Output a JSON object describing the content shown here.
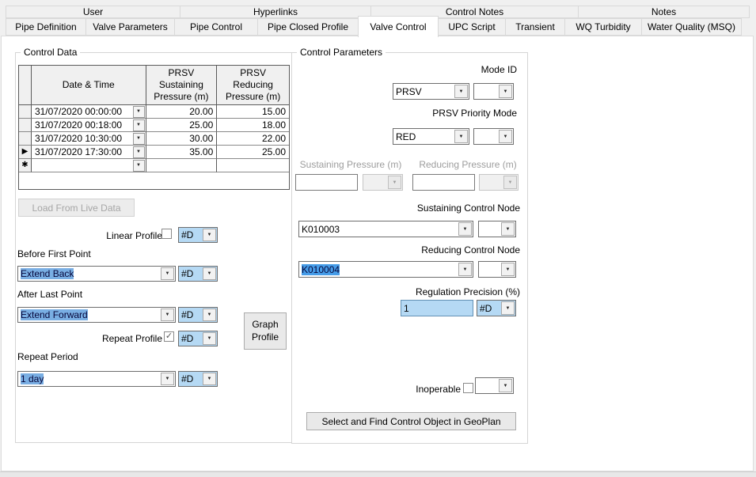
{
  "tabs": {
    "row1": [
      {
        "label": "User"
      },
      {
        "label": "Hyperlinks"
      },
      {
        "label": "Control Notes"
      },
      {
        "label": "Notes"
      }
    ],
    "row2": [
      {
        "label": "Pipe Definition"
      },
      {
        "label": "Valve Parameters"
      },
      {
        "label": "Pipe Control"
      },
      {
        "label": "Pipe Closed Profile"
      },
      {
        "label": "Valve Control",
        "active": true
      },
      {
        "label": "UPC Script"
      },
      {
        "label": "Transient"
      },
      {
        "label": "WQ Turbidity"
      },
      {
        "label": "Water Quality (MSQ)"
      }
    ],
    "active_tab": "Valve Control"
  },
  "control_data": {
    "title": "Control Data",
    "table": {
      "columns": [
        "Date & Time",
        "PRSV Sustaining Pressure (m)",
        "PRSV Reducing Pressure (m)"
      ],
      "rows": [
        {
          "marker": "",
          "datetime": "31/07/2020 00:00:00",
          "sustaining": "20.00",
          "reducing": "15.00"
        },
        {
          "marker": "",
          "datetime": "31/07/2020 00:18:00",
          "sustaining": "25.00",
          "reducing": "18.00"
        },
        {
          "marker": "",
          "datetime": "31/07/2020 10:30:00",
          "sustaining": "30.00",
          "reducing": "22.00"
        },
        {
          "marker": "▶",
          "datetime": "31/07/2020 17:30:00",
          "sustaining": "35.00",
          "reducing": "25.00"
        },
        {
          "marker": "✱",
          "datetime": "",
          "sustaining": "",
          "reducing": ""
        }
      ]
    },
    "load_button": "Load From Live Data",
    "linear_profile": {
      "label": "Linear Profile",
      "checked": false,
      "flag": "#D"
    },
    "before_first_point": {
      "label": "Before First Point",
      "value": "Extend Back",
      "flag": "#D"
    },
    "after_last_point": {
      "label": "After Last Point",
      "value": "Extend Forward",
      "flag": "#D"
    },
    "graph_button": "Graph Profile",
    "repeat_profile": {
      "label": "Repeat Profile",
      "checked": true,
      "flag": "#D"
    },
    "repeat_period": {
      "label": "Repeat Period",
      "value": "1 day",
      "flag": "#D"
    }
  },
  "control_parameters": {
    "title": "Control Parameters",
    "mode_id": {
      "label": "Mode ID",
      "value": "PRSV",
      "flag": ""
    },
    "priority_mode": {
      "label": "PRSV Priority Mode",
      "value": "RED",
      "flag": ""
    },
    "sustaining_pressure": {
      "label": "Sustaining Pressure (m)",
      "value": "",
      "disabled": true
    },
    "reducing_pressure": {
      "label": "Reducing Pressure (m)",
      "value": "",
      "disabled": true
    },
    "sustaining_control_node": {
      "label": "Sustaining Control Node",
      "value": "K010003",
      "flag": ""
    },
    "reducing_control_node": {
      "label": "Reducing Control Node",
      "value": "K010004",
      "flag": ""
    },
    "regulation_precision": {
      "label": "Regulation Precision (%)",
      "value": "1",
      "flag": "#D"
    },
    "inoperable": {
      "label": "Inoperable",
      "checked": false,
      "flag": ""
    },
    "geoplan_button": "Select and Find Control Object in GeoPlan"
  },
  "icons": {
    "dropdown_arrow": "▼",
    "current_row_marker": "▶",
    "new_row_marker": "✱",
    "checkmark": "✓"
  },
  "colors": {
    "highlight_blue_fill": "#b5d9f4",
    "selection_blue": "#79aee3",
    "selection_blue_strong": "#459ce8",
    "tab_bg": "#f0f0f0",
    "panel_bg": "#ffffff",
    "border_gray": "#d9d9d9",
    "disabled_text": "#a6a6a6"
  }
}
